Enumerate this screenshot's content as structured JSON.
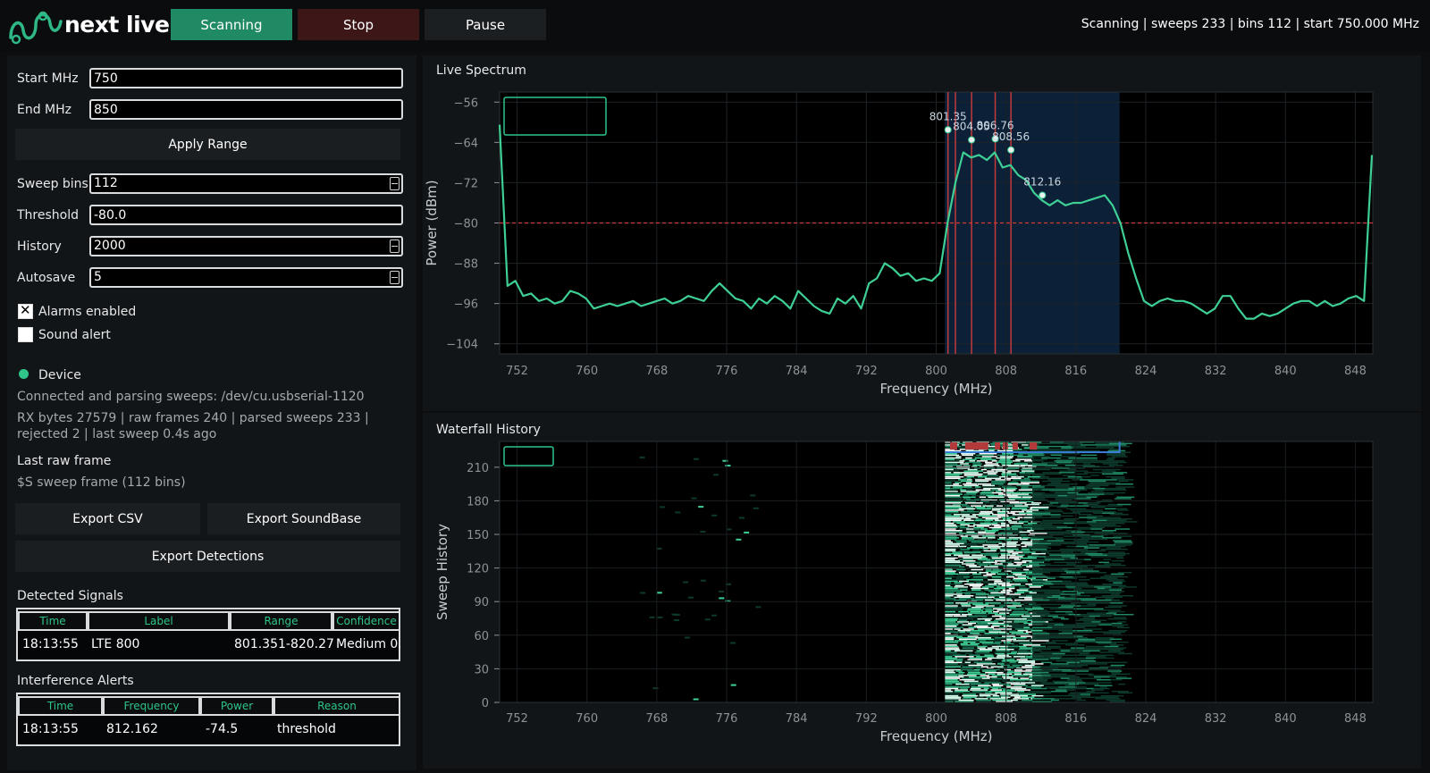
{
  "app": {
    "logo_text": "next live"
  },
  "toolbar": {
    "scanning_label": "Scanning",
    "stop_label": "Stop",
    "pause_label": "Pause"
  },
  "status": {
    "text": "Scanning | sweeps 233 | bins 112 | start 750.000 MHz"
  },
  "settings": {
    "start_label": "Start MHz",
    "start_value": "750",
    "end_label": "End MHz",
    "end_value": "850",
    "apply_label": "Apply Range",
    "bins_label": "Sweep bins",
    "bins_value": "112",
    "threshold_label": "Threshold",
    "threshold_value": "-80.0",
    "history_label": "History",
    "history_value": "2000",
    "autosave_label": "Autosave",
    "autosave_value": "5",
    "alarms_label": "Alarms enabled",
    "alarms_checked": true,
    "sound_label": "Sound alert",
    "sound_checked": false
  },
  "device": {
    "title": "Device",
    "connection": "Connected and parsing sweeps: /dev/cu.usbserial-1120",
    "stats_line1": "RX bytes 27579 | raw frames 240 | parsed sweeps 233 |",
    "stats_line2": "rejected 2 | last sweep 0.4s ago",
    "last_frame_title": "Last raw frame",
    "last_frame_value": "$S sweep frame (112 bins)",
    "status_color": "#2ec48a"
  },
  "exports": {
    "csv_label": "Export CSV",
    "soundbase_label": "Export SoundBase",
    "detections_label": "Export Detections"
  },
  "detected": {
    "title": "Detected Signals",
    "headers": [
      "Time",
      "Label",
      "Range",
      "Confidence"
    ],
    "rows": [
      {
        "time": "18:13:55",
        "label": "LTE 800",
        "range": "801.351-820.27",
        "confidence": "Medium 0."
      }
    ]
  },
  "alerts": {
    "title": "Interference Alerts",
    "headers": [
      "Time",
      "Frequency",
      "Power",
      "Reason"
    ],
    "rows": [
      {
        "time": "18:13:55",
        "frequency": "812.162",
        "power": "-74.5",
        "reason": "threshold"
      }
    ]
  },
  "spectrum": {
    "title": "Live Spectrum"
  },
  "waterfall": {
    "title": "Waterfall History"
  },
  "chart_data": [
    {
      "type": "line",
      "title": "Live Spectrum",
      "xlabel": "Frequency (MHz)",
      "ylabel": "Power (dBm)",
      "xlim": [
        750,
        850
      ],
      "ylim": [
        -106,
        -54
      ],
      "xticks": [
        752,
        760,
        768,
        776,
        784,
        792,
        800,
        808,
        816,
        824,
        832,
        840,
        848
      ],
      "yticks": [
        -56,
        -64,
        -72,
        -80,
        -88,
        -96,
        -104
      ],
      "threshold_dbm": -80,
      "line_color": "#3ecf95",
      "highlight_range_mhz": [
        801,
        821
      ],
      "marker_lines_mhz": [
        801.35,
        802.2,
        804.05,
        806.76,
        808.56
      ],
      "peaks": [
        {
          "x": 801.35,
          "y": -61.5,
          "label": "801.35"
        },
        {
          "x": 804.05,
          "y": -63.5,
          "label": "804.05"
        },
        {
          "x": 806.76,
          "y": -63.3,
          "label": "806.76"
        },
        {
          "x": 808.56,
          "y": -65.5,
          "label": "808.56"
        },
        {
          "x": 812.16,
          "y": -74.5,
          "label": "812.16"
        }
      ],
      "x": [
        750.0,
        750.9,
        751.8,
        752.7,
        753.6,
        754.5,
        755.4,
        756.3,
        757.2,
        758.1,
        759.0,
        759.9,
        760.8,
        761.7,
        762.6,
        763.5,
        764.4,
        765.3,
        766.2,
        767.1,
        768.0,
        768.9,
        769.8,
        770.7,
        771.6,
        772.5,
        773.4,
        774.3,
        775.2,
        776.1,
        777.0,
        777.9,
        778.8,
        779.7,
        780.6,
        781.5,
        782.4,
        783.3,
        784.2,
        785.1,
        786.0,
        786.9,
        787.8,
        788.7,
        789.6,
        790.5,
        791.4,
        792.3,
        793.2,
        794.1,
        795.0,
        795.9,
        796.8,
        797.7,
        798.6,
        799.5,
        800.4,
        801.3,
        802.2,
        803.1,
        804.0,
        804.9,
        805.8,
        806.7,
        807.6,
        808.5,
        809.4,
        810.3,
        811.2,
        812.1,
        813.0,
        813.9,
        814.8,
        815.7,
        816.6,
        817.5,
        818.4,
        819.3,
        820.2,
        821.1,
        822.0,
        822.9,
        823.8,
        824.7,
        825.6,
        826.5,
        827.4,
        828.3,
        829.2,
        830.1,
        831.0,
        831.9,
        832.8,
        833.7,
        834.6,
        835.5,
        836.4,
        837.3,
        838.2,
        839.1,
        840.0,
        840.9,
        841.8,
        842.7,
        843.6,
        844.5,
        845.4,
        846.3,
        847.2,
        848.1,
        849.0,
        849.9
      ],
      "y": [
        -60.5,
        -92.5,
        -91.5,
        -94.5,
        -94.0,
        -95.5,
        -95.0,
        -96.0,
        -95.5,
        -93.5,
        -94.0,
        -95.0,
        -97.0,
        -96.5,
        -96.0,
        -96.5,
        -96.0,
        -95.5,
        -96.5,
        -96.0,
        -95.5,
        -95.0,
        -96.0,
        -95.5,
        -94.5,
        -95.0,
        -95.5,
        -93.5,
        -92.0,
        -93.5,
        -95.0,
        -95.5,
        -97.0,
        -95.0,
        -96.0,
        -94.5,
        -95.5,
        -97.0,
        -93.5,
        -95.0,
        -96.5,
        -97.5,
        -98.0,
        -95.0,
        -96.0,
        -94.5,
        -97.0,
        -92.0,
        -91.0,
        -88.0,
        -89.0,
        -90.5,
        -90.0,
        -91.5,
        -91.0,
        -91.5,
        -90.0,
        -80.0,
        -72.0,
        -66.0,
        -67.0,
        -66.5,
        -67.5,
        -66.0,
        -69.0,
        -68.5,
        -70.5,
        -71.5,
        -74.0,
        -75.5,
        -76.5,
        -75.5,
        -76.5,
        -76.0,
        -76.0,
        -75.5,
        -75.0,
        -74.5,
        -76.5,
        -80.0,
        -86.0,
        -91.0,
        -95.5,
        -96.5,
        -95.5,
        -95.0,
        -95.5,
        -95.5,
        -96.0,
        -97.0,
        -98.0,
        -97.0,
        -94.5,
        -94.5,
        -97.0,
        -99.0,
        -99.0,
        -98.0,
        -98.5,
        -98.0,
        -97.0,
        -96.0,
        -95.5,
        -95.5,
        -96.5,
        -95.5,
        -96.5,
        -96.0,
        -95.0,
        -94.5,
        -95.5,
        -66.5
      ]
    },
    {
      "type": "heatmap",
      "title": "Waterfall History",
      "xlabel": "Frequency (MHz)",
      "ylabel": "Sweep History",
      "xlim": [
        750,
        850
      ],
      "ylim": [
        0,
        233
      ],
      "xticks": [
        752,
        760,
        768,
        776,
        784,
        792,
        800,
        808,
        816,
        824,
        832,
        840,
        848
      ],
      "yticks": [
        0,
        30,
        60,
        90,
        120,
        150,
        180,
        210
      ],
      "active_band_mhz": [
        801,
        821
      ],
      "strong_band_mhz": [
        801,
        811
      ],
      "colormap": [
        "#000000",
        "#0d3a2c",
        "#1f8a64",
        "#3ecf95",
        "#d6ffef",
        "#ffffff"
      ]
    }
  ]
}
